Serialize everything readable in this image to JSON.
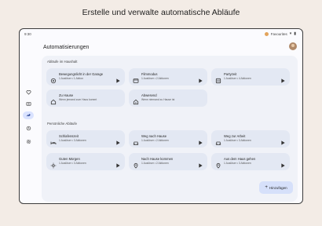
{
  "headline": "Erstelle und verwalte automatische Abläufe",
  "status": {
    "time": "9:30",
    "account": "Favourites"
  },
  "header": {
    "title": "Automatisierungen"
  },
  "rail": [
    "heart-icon",
    "devices-icon",
    "automation-icon",
    "history-icon",
    "settings-icon"
  ],
  "household": {
    "label": "Abläufe im Haushalt",
    "cards": [
      {
        "name": "Bewegungslicht in der Garage",
        "sub": "1 Auslöser • 1 Aktion",
        "icon": "motion-icon"
      },
      {
        "name": "Filmmodus",
        "sub": "1 Auslöser • 2 Aktionen",
        "icon": "film-icon"
      },
      {
        "name": "Partyzeit",
        "sub": "1 Auslöser • 4 Aktionen",
        "icon": "party-icon"
      },
      {
        "name": "Zu Hause",
        "sub": "Wenn jemand zum Haus kommt",
        "icon": "home-icon"
      },
      {
        "name": "Abwesend",
        "sub": "Wenn niemand zu Hause ist",
        "icon": "away-icon"
      }
    ]
  },
  "personal": {
    "label": "Persönliche Abläufe",
    "cards": [
      {
        "name": "Schlafenszeit",
        "sub": "1 Auslöser • 3 Aktionen",
        "icon": "bed-icon"
      },
      {
        "name": "Weg nach Hause",
        "sub": "1 Auslöser • 2 Aktionen",
        "icon": "car-icon"
      },
      {
        "name": "Weg zur Arbeit",
        "sub": "1 Auslöser • 3 Aktionen",
        "icon": "car-icon"
      },
      {
        "name": "Guten Morgen",
        "sub": "1 Auslöser • 3 Aktionen",
        "icon": "sun-icon"
      },
      {
        "name": "Nach Hause kommen",
        "sub": "1 Auslöser • 2 Aktionen",
        "icon": "location-icon"
      },
      {
        "name": "Aus dem Haus gehen",
        "sub": "1 Auslöser • 3 Aktionen",
        "icon": "location-icon"
      }
    ]
  },
  "add_button": {
    "label": "Hinzufügen"
  },
  "colors": {
    "background": "#f3ece6",
    "accent": "#d6e0fa",
    "card": "#e3e8f3",
    "rail_active": "#d9e2ff"
  }
}
